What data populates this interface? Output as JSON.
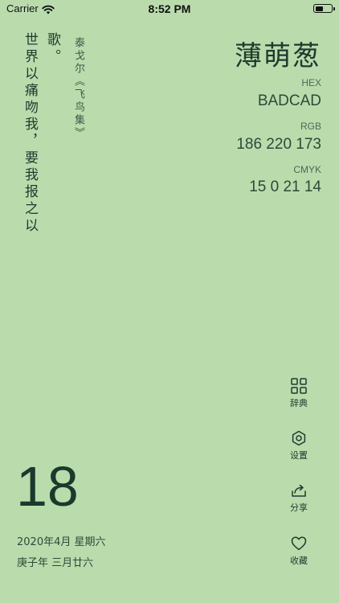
{
  "status_bar": {
    "carrier": "Carrier",
    "time": "8:52 PM"
  },
  "poem": {
    "col1": "世界以痛吻我，要我报之以",
    "col2": "歌。",
    "attribution": "泰戈尔《飞鸟集》"
  },
  "color": {
    "name": "薄萌葱",
    "hex_label": "HEX",
    "hex_value": "BADCAD",
    "rgb_label": "RGB",
    "rgb_value": "186 220 173",
    "cmyk_label": "CMYK",
    "cmyk_value": "15 0 21 14",
    "background": "#BADCAD"
  },
  "actions": {
    "dictionary": "辞典",
    "settings": "设置",
    "share": "分享",
    "favorite": "收藏"
  },
  "date": {
    "day": "18",
    "gregorian": "2020年4月 星期六",
    "lunar": "庚子年 三月廿六"
  }
}
